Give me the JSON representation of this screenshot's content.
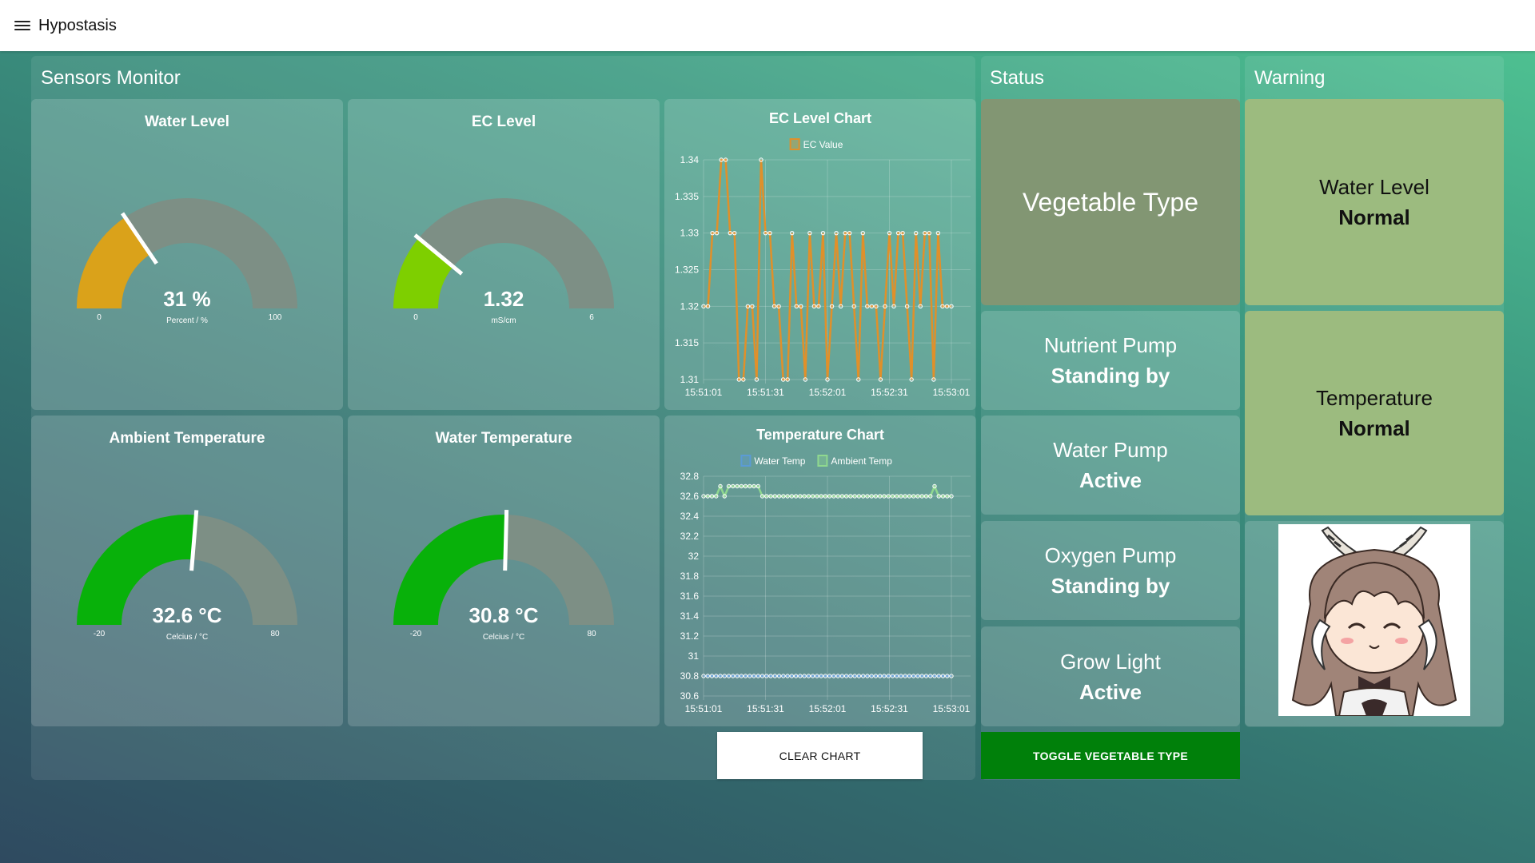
{
  "app": {
    "title": "Hypostasis"
  },
  "sensors": {
    "title": "Sensors Monitor",
    "gauges": {
      "water_level": {
        "title": "Water Level",
        "value": 31,
        "display": "31 %",
        "unit": "Percent / %",
        "min": 0,
        "max": 100,
        "min_label": "0",
        "max_label": "100",
        "color": "#daa21a"
      },
      "ec_level": {
        "title": "EC Level",
        "value": 1.32,
        "display": "1.32",
        "unit": "mS/cm",
        "min": 0,
        "max": 6,
        "min_label": "0",
        "max_label": "6",
        "color": "#7ecf00"
      },
      "ambient_temp": {
        "title": "Ambient Temperature",
        "value": 32.6,
        "display": "32.6 °C",
        "unit": "Celcius / °C",
        "min": -20,
        "max": 80,
        "min_label": "-20",
        "max_label": "80",
        "color": "#08b10a"
      },
      "water_temp": {
        "title": "Water Temperature",
        "value": 30.8,
        "display": "30.8 °C",
        "unit": "Celcius / °C",
        "min": -20,
        "max": 80,
        "min_label": "-20",
        "max_label": "80",
        "color": "#08b10a"
      }
    },
    "clear_chart_label": "CLEAR CHART"
  },
  "chart_data": [
    {
      "type": "line",
      "title": "EC Level Chart",
      "series": [
        {
          "name": "EC Value",
          "color": "#e0902a",
          "values": [
            1.32,
            1.32,
            1.33,
            1.33,
            1.34,
            1.34,
            1.33,
            1.33,
            1.31,
            1.31,
            1.32,
            1.32,
            1.31,
            1.34,
            1.33,
            1.33,
            1.32,
            1.32,
            1.31,
            1.31,
            1.33,
            1.32,
            1.32,
            1.31,
            1.33,
            1.32,
            1.32,
            1.33,
            1.31,
            1.32,
            1.33,
            1.32,
            1.33,
            1.33,
            1.32,
            1.31,
            1.33,
            1.32,
            1.32,
            1.32,
            1.31,
            1.32,
            1.33,
            1.32,
            1.33,
            1.33,
            1.32,
            1.31,
            1.33,
            1.32,
            1.33,
            1.33,
            1.31,
            1.33,
            1.32,
            1.32,
            1.32
          ]
        }
      ],
      "x_tick_labels": [
        "15:51:01",
        "15:51:31",
        "15:52:01",
        "15:52:31",
        "15:53:01"
      ],
      "y_tick_labels": [
        "1.34",
        "1.335",
        "1.33",
        "1.325",
        "1.32",
        "1.315",
        "1.31"
      ],
      "ylim": [
        1.31,
        1.34
      ],
      "grid": true,
      "legend": "top"
    },
    {
      "type": "line",
      "title": "Temperature Chart",
      "series": [
        {
          "name": "Water Temp",
          "color": "#5b9bd5",
          "values": [
            30.8,
            30.8,
            30.8,
            30.8,
            30.8,
            30.8,
            30.8,
            30.8,
            30.8,
            30.8,
            30.8,
            30.8,
            30.8,
            30.8,
            30.8,
            30.8,
            30.8,
            30.8,
            30.8,
            30.8,
            30.8,
            30.8,
            30.8,
            30.8,
            30.8,
            30.8,
            30.8,
            30.8,
            30.8,
            30.8,
            30.8,
            30.8,
            30.8,
            30.8,
            30.8,
            30.8,
            30.8,
            30.8,
            30.8,
            30.8,
            30.8,
            30.8,
            30.8,
            30.8,
            30.8,
            30.8,
            30.8,
            30.8,
            30.8,
            30.8,
            30.8,
            30.8,
            30.8,
            30.8,
            30.8,
            30.8,
            30.8,
            30.8,
            30.8,
            30.8
          ]
        },
        {
          "name": "Ambient Temp",
          "color": "#8fd88f",
          "values": [
            32.6,
            32.6,
            32.6,
            32.6,
            32.7,
            32.6,
            32.7,
            32.7,
            32.7,
            32.7,
            32.7,
            32.7,
            32.7,
            32.7,
            32.6,
            32.6,
            32.6,
            32.6,
            32.6,
            32.6,
            32.6,
            32.6,
            32.6,
            32.6,
            32.6,
            32.6,
            32.6,
            32.6,
            32.6,
            32.6,
            32.6,
            32.6,
            32.6,
            32.6,
            32.6,
            32.6,
            32.6,
            32.6,
            32.6,
            32.6,
            32.6,
            32.6,
            32.6,
            32.6,
            32.6,
            32.6,
            32.6,
            32.6,
            32.6,
            32.6,
            32.6,
            32.6,
            32.6,
            32.6,
            32.6,
            32.7,
            32.6,
            32.6,
            32.6,
            32.6
          ]
        }
      ],
      "x_tick_labels": [
        "15:51:01",
        "15:51:31",
        "15:52:01",
        "15:52:31",
        "15:53:01"
      ],
      "y_tick_labels": [
        "32.8",
        "32.6",
        "32.4",
        "32.2",
        "32",
        "31.8",
        "31.6",
        "31.4",
        "31.2",
        "31",
        "30.8",
        "30.6"
      ],
      "ylim": [
        30.6,
        32.8
      ],
      "grid": true,
      "legend": "top"
    }
  ],
  "status": {
    "title": "Status",
    "vegetable_type_label": "Vegetable Type",
    "items": [
      {
        "label": "Nutrient Pump",
        "value": "Standing by"
      },
      {
        "label": "Water Pump",
        "value": "Active"
      },
      {
        "label": "Oxygen Pump",
        "value": "Standing by"
      },
      {
        "label": "Grow Light",
        "value": "Active"
      }
    ],
    "toggle_label": "TOGGLE VEGETABLE TYPE"
  },
  "warning": {
    "title": "Warning",
    "items": [
      {
        "label": "Water Level",
        "value": "Normal"
      },
      {
        "label": "Temperature",
        "value": "Normal"
      }
    ],
    "mascot_icon": "chibi-character-image"
  }
}
